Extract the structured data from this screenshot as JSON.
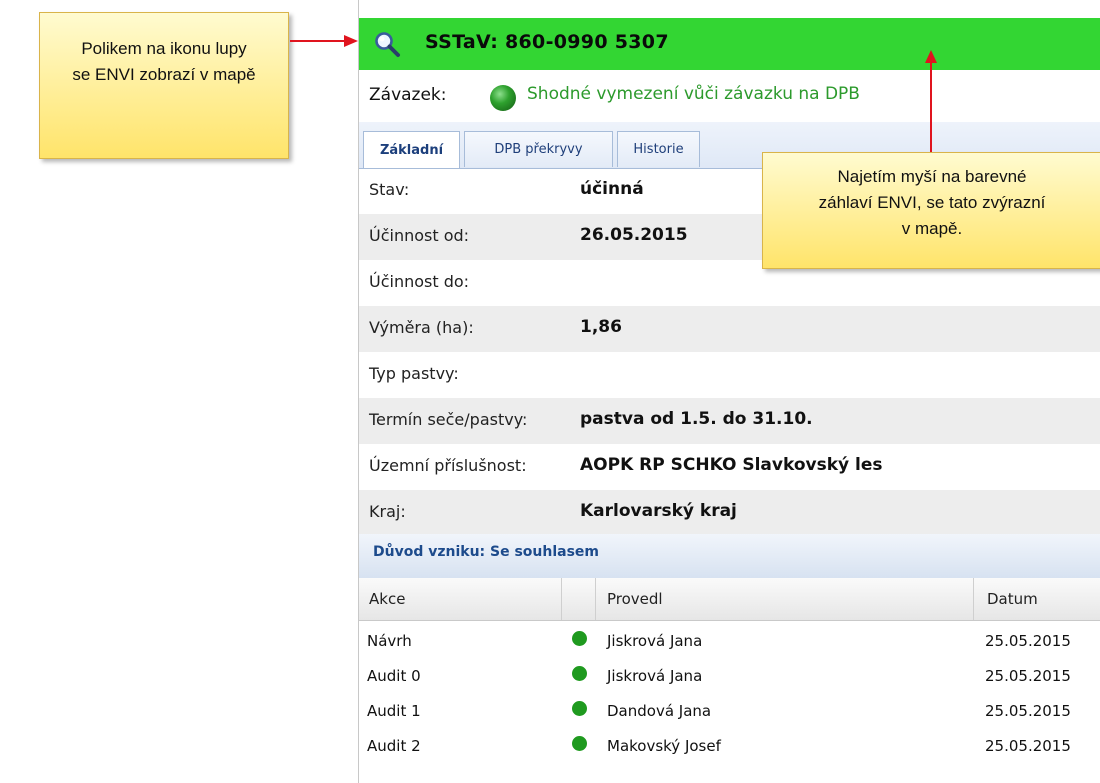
{
  "header": {
    "title": "SSTaV: 860-0990 5307",
    "icon": "magnifier-icon",
    "bg_color": "#33d633"
  },
  "zavazek": {
    "label": "Závazek:",
    "status_text": "Shodné vymezení vůči závazku na DPB",
    "status_color": "#2c9a2c"
  },
  "tabs": [
    {
      "label": "Základní",
      "active": true
    },
    {
      "label": "DPB překryvy",
      "active": false
    },
    {
      "label": "Historie",
      "active": false
    }
  ],
  "details": [
    {
      "label": "Stav:",
      "value": "účinná"
    },
    {
      "label": "Účinnost od:",
      "value": "26.05.2015"
    },
    {
      "label": "Účinnost do:",
      "value": ""
    },
    {
      "label": "Výměra (ha):",
      "value": "1,86"
    },
    {
      "label": "Typ pastvy:",
      "value": ""
    },
    {
      "label": "Termín seče/pastvy:",
      "value": "pastva od 1.5. do 31.10."
    },
    {
      "label": "Územní příslušnost:",
      "value": "AOPK RP SCHKO Slavkovský les"
    },
    {
      "label": "Kraj:",
      "value": "Karlovarský kraj"
    }
  ],
  "reason": {
    "text": "Důvod vzniku: Se souhlasem"
  },
  "history": {
    "columns": [
      "Akce",
      "",
      "Provedl",
      "Datum"
    ],
    "rows": [
      {
        "akce": "Návrh",
        "provedl": "Jiskrová Jana",
        "datum": "25.05.2015"
      },
      {
        "akce": "Audit 0",
        "provedl": "Jiskrová Jana",
        "datum": "25.05.2015"
      },
      {
        "akce": "Audit 1",
        "provedl": "Dandová Jana",
        "datum": "25.05.2015"
      },
      {
        "akce": "Audit 2",
        "provedl": "Makovský Josef",
        "datum": "25.05.2015"
      }
    ]
  },
  "callouts": {
    "left": {
      "line1": "Polikem na ikonu lupy",
      "line2": "se ENVI zobrazí v mapě"
    },
    "right": {
      "line1": "Najetím myší na barevné",
      "line2": "záhlaví ENVI, se tato zvýrazní",
      "line3": "v mapě."
    },
    "arrow_color": "#e0141e"
  }
}
